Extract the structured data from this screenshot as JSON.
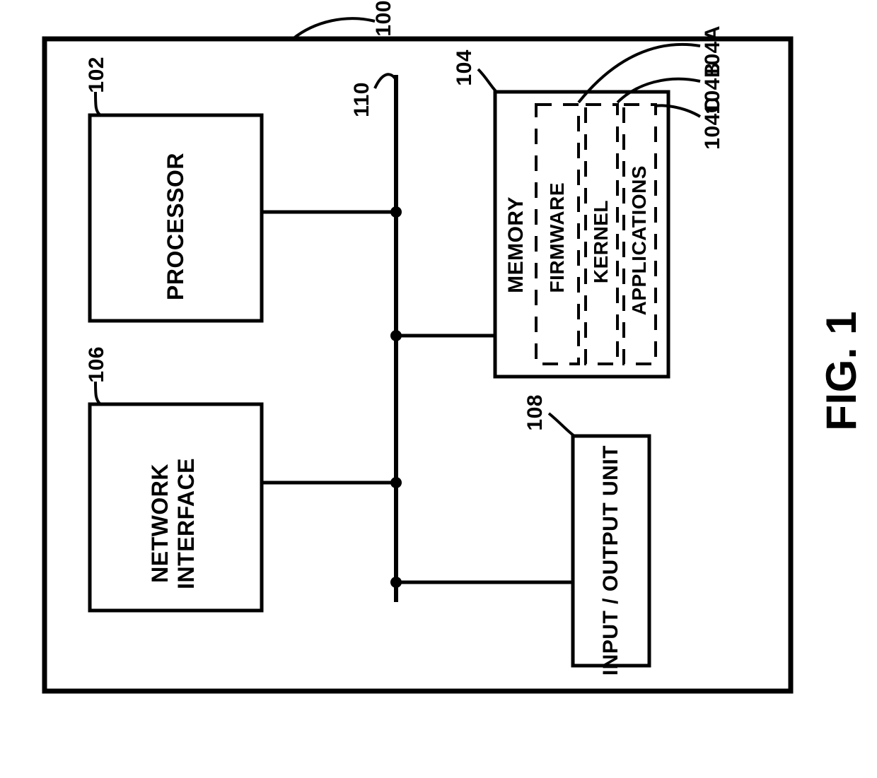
{
  "figure_caption": "FIG. 1",
  "outer_block": {
    "ref": "100"
  },
  "bus": {
    "ref": "110"
  },
  "processor": {
    "label": "PROCESSOR",
    "ref": "102"
  },
  "network_interface": {
    "label": "NETWORK\nINTERFACE",
    "ref": "106"
  },
  "memory": {
    "label": "MEMORY",
    "ref": "104",
    "sections": {
      "firmware": {
        "label": "FIRMWARE",
        "ref": "104A"
      },
      "kernel": {
        "label": "KERNEL",
        "ref": "104B"
      },
      "applications": {
        "label": "APPLICATIONS",
        "ref": "104C"
      }
    }
  },
  "io_unit": {
    "label": "INPUT / OUTPUT UNIT",
    "ref": "108"
  }
}
